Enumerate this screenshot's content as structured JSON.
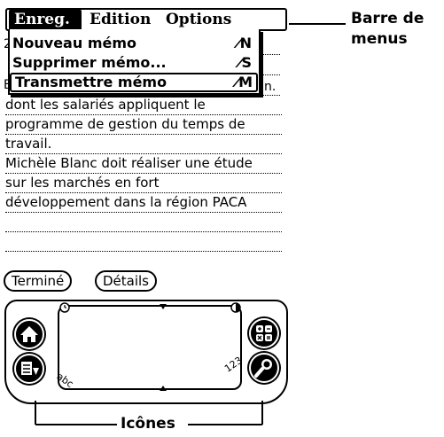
{
  "menubar": {
    "items": [
      {
        "label": "Enreg.",
        "active": true
      },
      {
        "label": "Edition",
        "active": false
      },
      {
        "label": "Options",
        "active": false
      }
    ]
  },
  "dropdown": {
    "items": [
      {
        "label": "Nouveau mémo",
        "shortcut": "N"
      },
      {
        "label": "Supprimer mémo...",
        "shortcut": "S"
      },
      {
        "label": "Transmettre mémo",
        "shortcut": "M"
      }
    ]
  },
  "memo": {
    "fragments": [
      "2",
      "B",
      "n."
    ],
    "lines": [
      "dont les salariés appliquent le",
      "programme de gestion du temps de",
      "travail.",
      "Michèle Blanc  doit réaliser une étude",
      "sur les marchés en fort",
      "développement dans la région PACA"
    ]
  },
  "buttons": {
    "done": "Terminé",
    "details": "Détails"
  },
  "graffiti": {
    "abc": "abc",
    "num": "123"
  },
  "callouts": {
    "menu_bar_line1": "Barre de",
    "menu_bar_line2": "menus",
    "icons": "Icônes"
  }
}
